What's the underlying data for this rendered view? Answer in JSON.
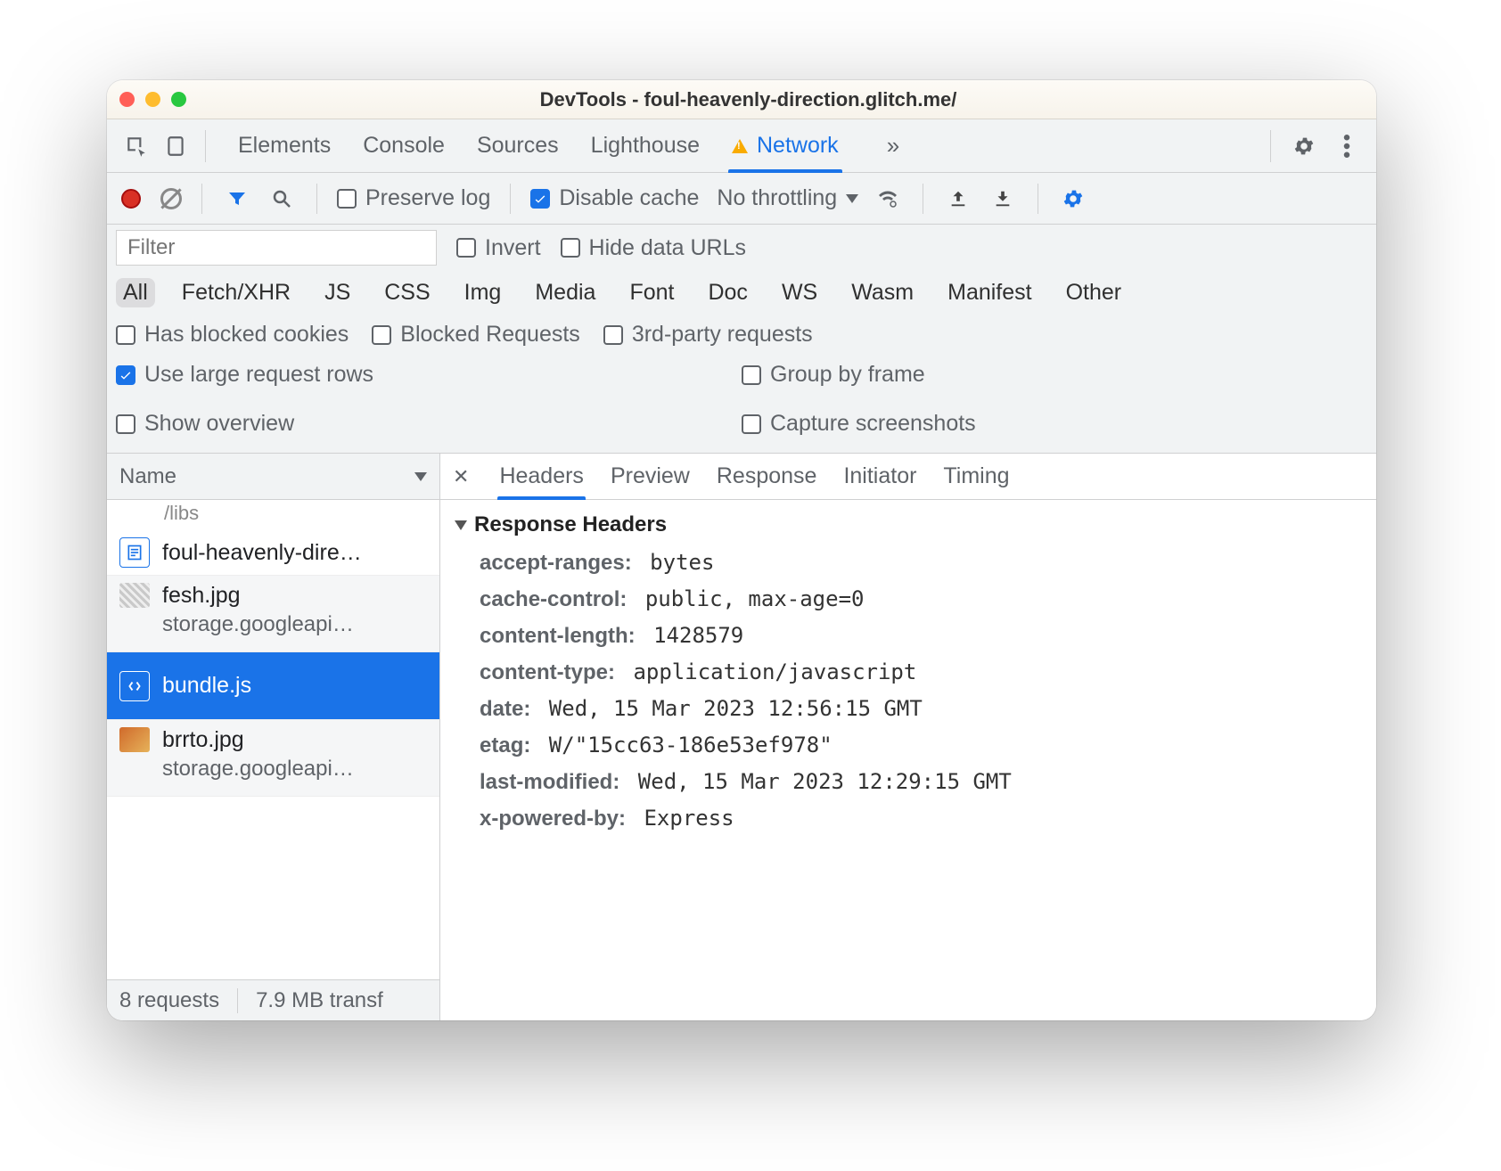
{
  "window": {
    "title": "DevTools - foul-heavenly-direction.glitch.me/"
  },
  "main_tabs": {
    "elements": "Elements",
    "console": "Console",
    "sources": "Sources",
    "lighthouse": "Lighthouse",
    "network": "Network",
    "more": "»"
  },
  "toolbar": {
    "preserve_log": "Preserve log",
    "disable_cache": "Disable cache",
    "throttling": "No throttling"
  },
  "filterbar": {
    "placeholder": "Filter",
    "invert": "Invert",
    "hide_data_urls": "Hide data URLs",
    "types": [
      "All",
      "Fetch/XHR",
      "JS",
      "CSS",
      "Img",
      "Media",
      "Font",
      "Doc",
      "WS",
      "Wasm",
      "Manifest",
      "Other"
    ],
    "has_blocked_cookies": "Has blocked cookies",
    "blocked_requests": "Blocked Requests",
    "third_party": "3rd-party requests",
    "use_large_rows": "Use large request rows",
    "group_by_frame": "Group by frame",
    "show_overview": "Show overview",
    "capture_screenshots": "Capture screenshots"
  },
  "list": {
    "column": "Name",
    "fragment": "/libs",
    "rows": [
      {
        "primary": "foul-heavenly-dire…",
        "secondary": "",
        "kind": "doc"
      },
      {
        "primary": "fesh.jpg",
        "secondary": "storage.googleapi…",
        "kind": "img"
      },
      {
        "primary": "bundle.js",
        "secondary": "",
        "kind": "js",
        "selected": true
      },
      {
        "primary": "brrto.jpg",
        "secondary": "storage.googleapi…",
        "kind": "img2"
      }
    ]
  },
  "detail": {
    "tabs": [
      "Headers",
      "Preview",
      "Response",
      "Initiator",
      "Timing"
    ],
    "active_tab": "Headers",
    "section_title": "Response Headers",
    "headers": [
      {
        "key": "accept-ranges:",
        "val": "bytes"
      },
      {
        "key": "cache-control:",
        "val": "public, max-age=0"
      },
      {
        "key": "content-length:",
        "val": "1428579"
      },
      {
        "key": "content-type:",
        "val": "application/javascript"
      },
      {
        "key": "date:",
        "val": "Wed, 15 Mar 2023 12:56:15 GMT"
      },
      {
        "key": "etag:",
        "val": "W/\"15cc63-186e53ef978\""
      },
      {
        "key": "last-modified:",
        "val": "Wed, 15 Mar 2023 12:29:15 GMT"
      },
      {
        "key": "x-powered-by:",
        "val": "Express"
      }
    ]
  },
  "status": {
    "requests": "8 requests",
    "transfer": "7.9 MB transf"
  }
}
